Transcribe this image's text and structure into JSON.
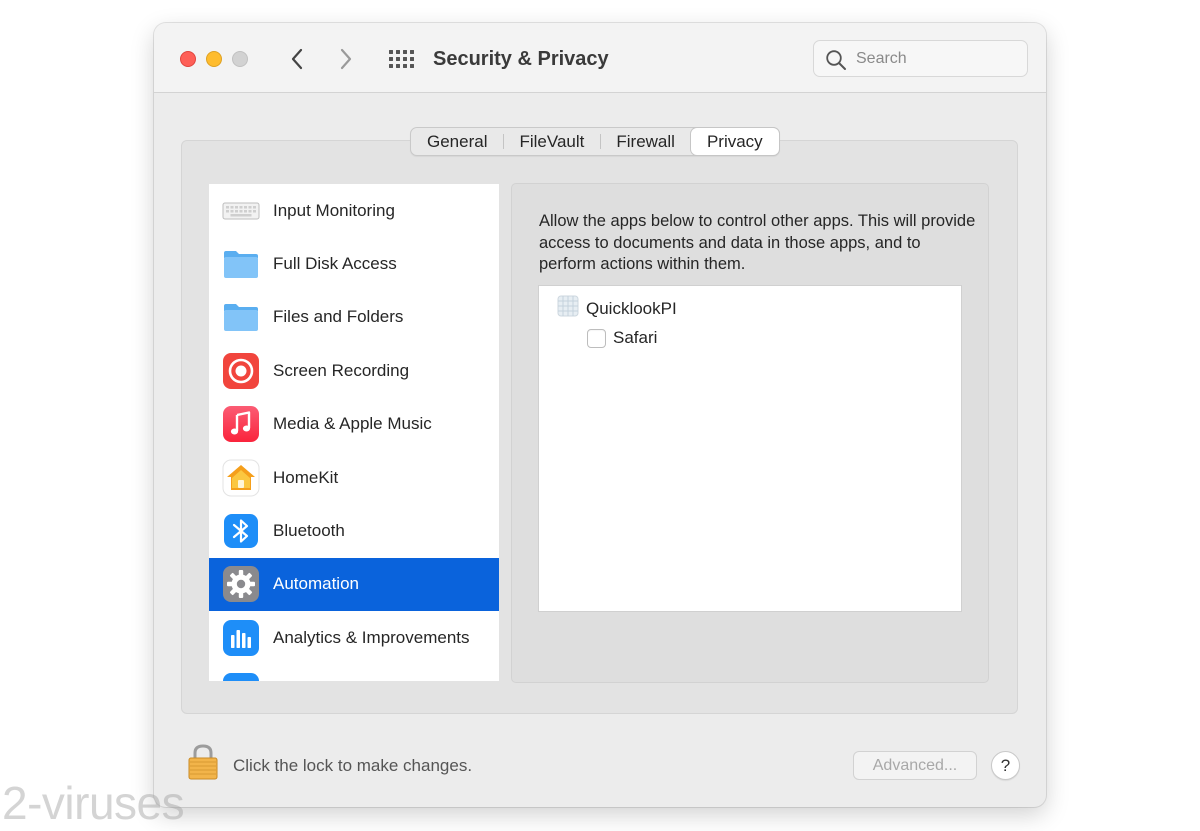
{
  "window": {
    "title": "Security & Privacy",
    "search": {
      "placeholder": "Search",
      "value": ""
    }
  },
  "tabs": [
    {
      "label": "General",
      "active": false
    },
    {
      "label": "FileVault",
      "active": false
    },
    {
      "label": "Firewall",
      "active": false
    },
    {
      "label": "Privacy",
      "active": true
    }
  ],
  "sidebar": {
    "items": [
      {
        "label": "Input Monitoring",
        "icon": "keyboard-icon",
        "selected": false
      },
      {
        "label": "Full Disk Access",
        "icon": "folder-icon",
        "selected": false
      },
      {
        "label": "Files and Folders",
        "icon": "folder-icon",
        "selected": false
      },
      {
        "label": "Screen Recording",
        "icon": "screen-recording-icon",
        "selected": false
      },
      {
        "label": "Media & Apple Music",
        "icon": "music-note-icon",
        "selected": false
      },
      {
        "label": "HomeKit",
        "icon": "home-icon",
        "selected": false
      },
      {
        "label": "Bluetooth",
        "icon": "bluetooth-icon",
        "selected": false
      },
      {
        "label": "Automation",
        "icon": "gear-icon",
        "selected": true
      },
      {
        "label": "Analytics & Improvements",
        "icon": "bar-chart-icon",
        "selected": false
      }
    ]
  },
  "detail": {
    "description": "Allow the apps below to control other apps. This will provide access to documents and data in those apps, and to perform actions within them.",
    "apps": [
      {
        "name": "QuicklookPI",
        "icon": "generic-app-icon",
        "children": [
          {
            "name": "Safari",
            "checked": false
          }
        ]
      }
    ]
  },
  "footer": {
    "lock_text": "Click the lock to make changes.",
    "advanced_label": "Advanced...",
    "help_label": "?"
  },
  "watermark": "2-viruses",
  "colors": {
    "selection": "#0a63dc",
    "close": "#fe5f57",
    "minimize": "#febc2e",
    "zoom_disabled": "#d2d2d2"
  }
}
